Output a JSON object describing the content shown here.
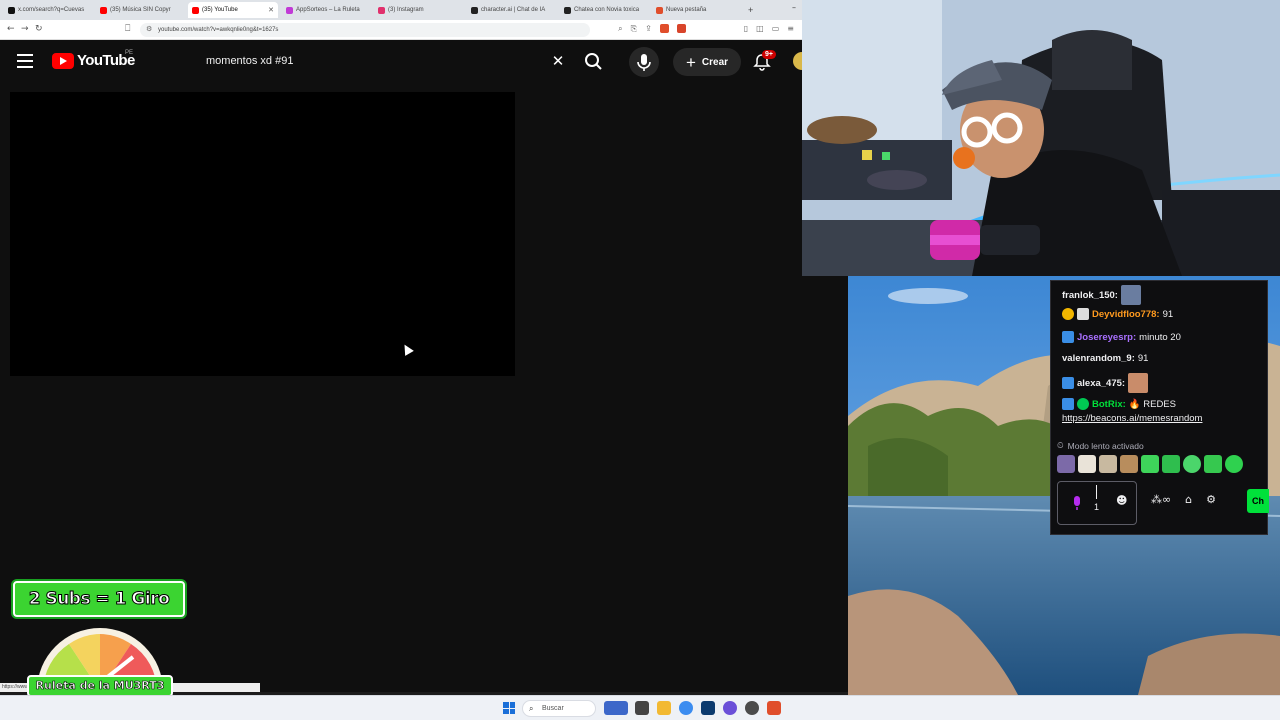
{
  "browser": {
    "tabs": [
      {
        "label": "x.com/search?q=Cuevas",
        "favicon_color": "#111111"
      },
      {
        "label": "(35) Música SIN Copyr",
        "favicon_color": "#ff0000"
      },
      {
        "label": "(35) YouTube",
        "favicon_color": "#ff0000"
      },
      {
        "label": "AppSorteos – La Ruleta",
        "favicon_color": "#c13ad6"
      },
      {
        "label": "(3) Instagram",
        "favicon_color": "#e1306c"
      },
      {
        "label": "character.ai | Chat de IA",
        "favicon_color": "#222222"
      },
      {
        "label": "Chatea con Novia toxica",
        "favicon_color": "#222222"
      },
      {
        "label": "Nueva pestaña",
        "favicon_color": "#e04e2b"
      }
    ],
    "new_tab": "+",
    "url": "youtube.com/watch?v=awkqnlie0ng&t=1627s",
    "status_url": "https://www.youtube.com/watch?v=... @jPoW9rZW50b3MgeGQgIz"
  },
  "youtube": {
    "logo_text": "YouTube",
    "country_code": "PE",
    "search_query": "momentos xd #91",
    "create_label": "Crear",
    "notifications_badge": "9+"
  },
  "chat": {
    "messages": [
      {
        "user": "franlok_150:",
        "user_color": "#efeff1",
        "text": ""
      },
      {
        "user": "Deyvidfloo778:",
        "user_color": "#ff9a1f",
        "text": " 91"
      },
      {
        "user": "Josereyesrp:",
        "user_color": "#a970ff",
        "text": " minuto 20"
      },
      {
        "user": "valenrandom_9:",
        "user_color": "#efeff1",
        "text": " 91"
      },
      {
        "user": "alexa_475:",
        "user_color": "#efeff1",
        "text": ""
      },
      {
        "user": "BotRix:",
        "user_color": "#00e13a",
        "text": " 🔥 REDES"
      }
    ],
    "link": "https://beacons.ai/memesrandom",
    "slow_mode": "Modo lento activado",
    "input_count": "1",
    "send_label": "Ch"
  },
  "overlay": {
    "subs_banner": "2 Subs = 1 Giro",
    "ruleta_label": "Ruleta de la MU3RT3"
  },
  "taskbar": {
    "search_placeholder": "Buscar"
  }
}
